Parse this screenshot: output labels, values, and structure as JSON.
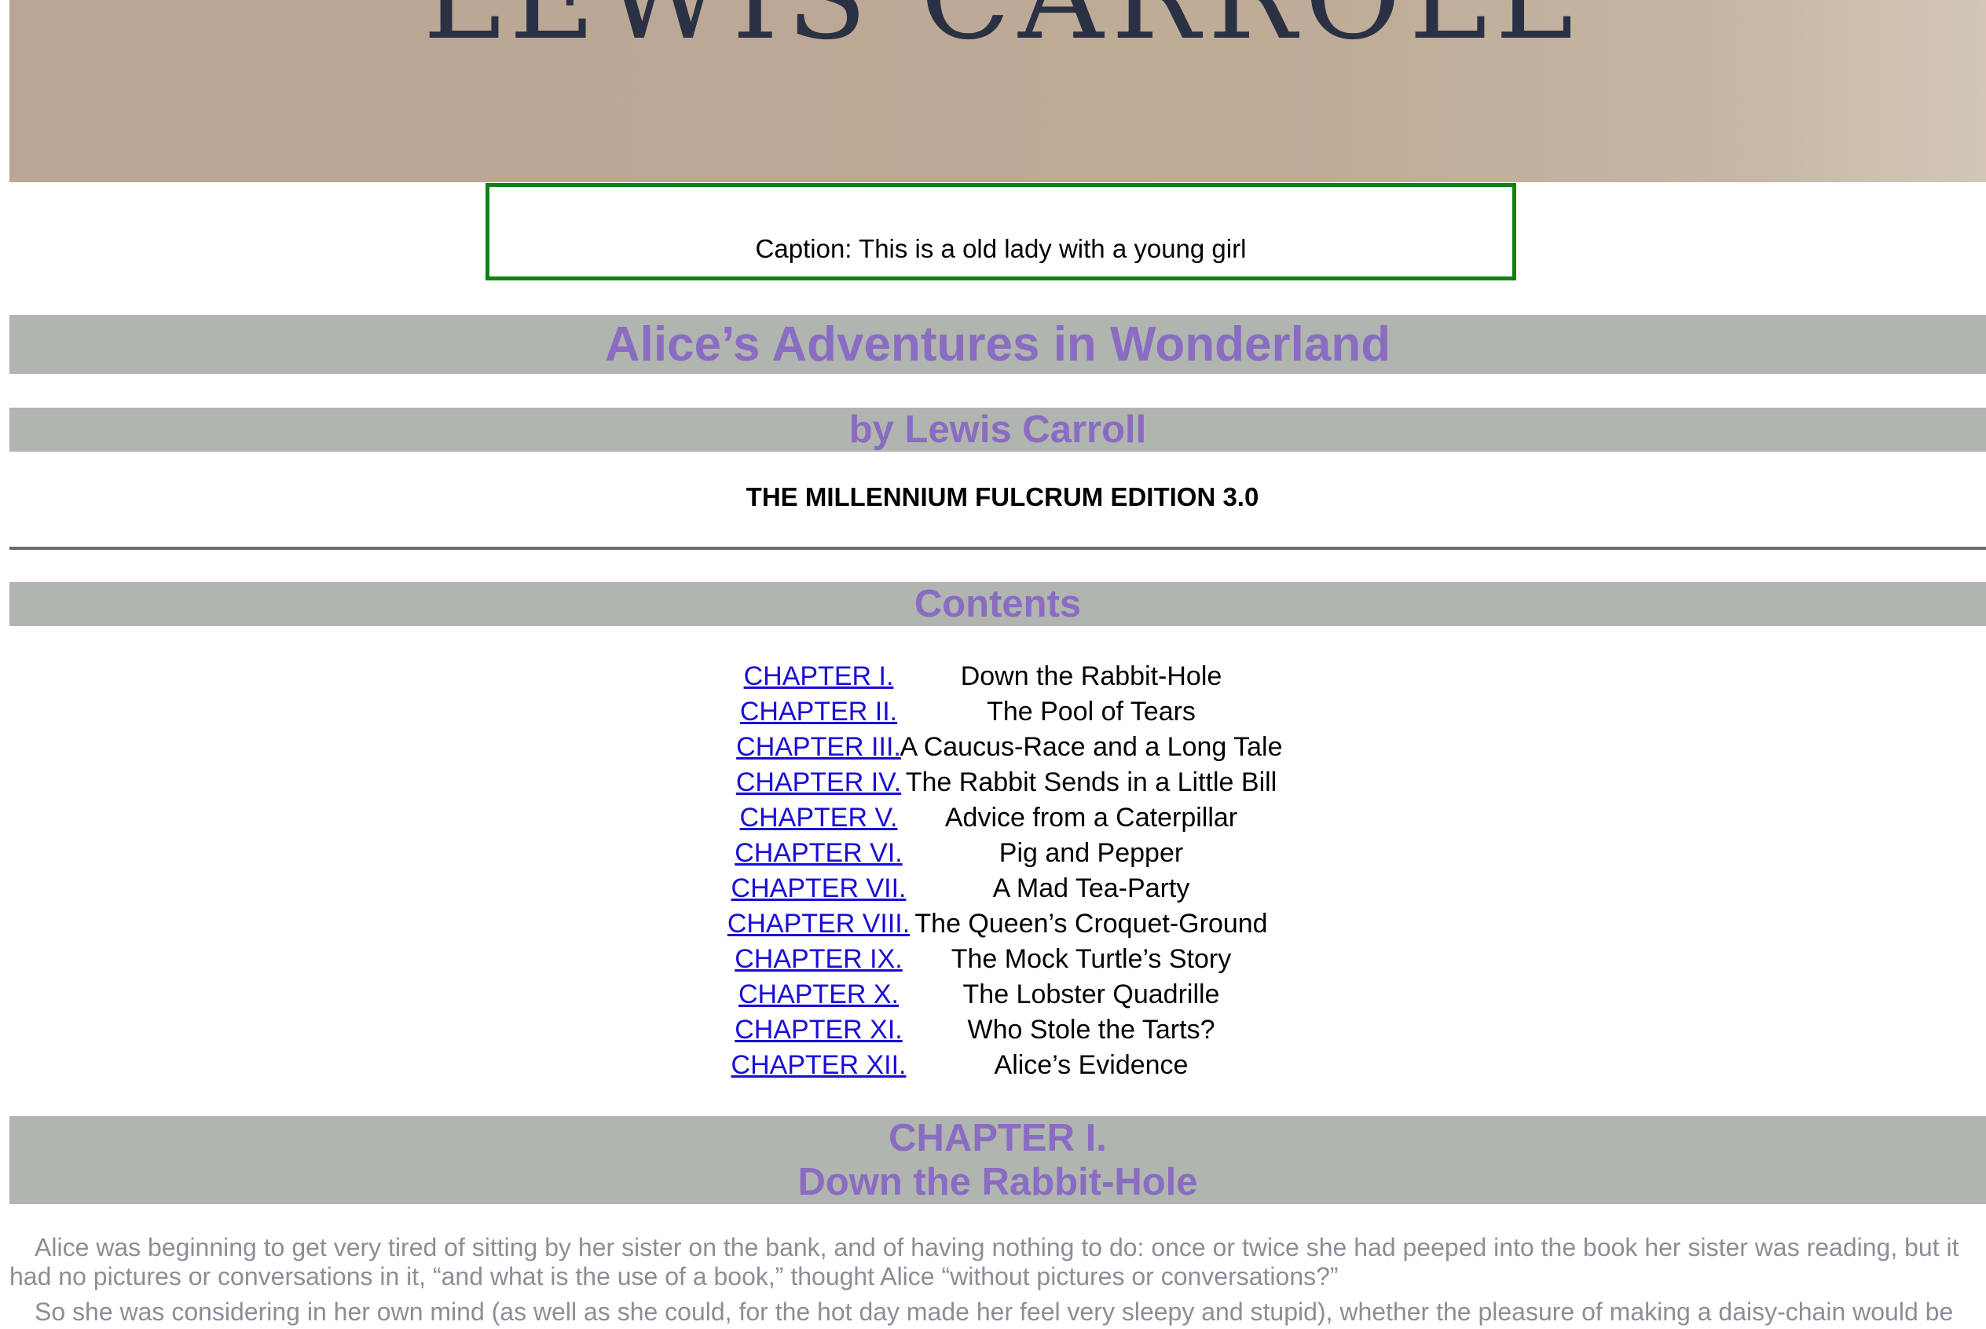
{
  "cover": {
    "text": "LEWIS CARROLL"
  },
  "caption": {
    "text": "Caption: This is a old lady with a young girl",
    "border_color": "#128112"
  },
  "book": {
    "title": "Alice’s Adventures in Wonderland",
    "author": "by Lewis Carroll",
    "edition": "THE MILLENNIUM FULCRUM EDITION 3.0"
  },
  "colors": {
    "heading_text": "#8a6cc2",
    "heading_band": "#b0b5b0",
    "link": "#1a0dd6",
    "body_text": "#8a8f97"
  },
  "contents": {
    "heading": "Contents",
    "items": [
      {
        "chapter": "CHAPTER I.",
        "title": "Down the Rabbit-Hole"
      },
      {
        "chapter": "CHAPTER II.",
        "title": "The Pool of Tears"
      },
      {
        "chapter": "CHAPTER III.",
        "title": "A Caucus-Race and a Long Tale"
      },
      {
        "chapter": "CHAPTER IV.",
        "title": "The Rabbit Sends in a Little Bill"
      },
      {
        "chapter": "CHAPTER V.",
        "title": "Advice from a Caterpillar"
      },
      {
        "chapter": "CHAPTER VI.",
        "title": "Pig and Pepper"
      },
      {
        "chapter": "CHAPTER VII.",
        "title": "A Mad Tea-Party"
      },
      {
        "chapter": "CHAPTER VIII.",
        "title": "The Queen’s Croquet-Ground"
      },
      {
        "chapter": "CHAPTER IX.",
        "title": "The Mock Turtle’s Story"
      },
      {
        "chapter": "CHAPTER X.",
        "title": "The Lobster Quadrille"
      },
      {
        "chapter": "CHAPTER XI.",
        "title": "Who Stole the Tarts?"
      },
      {
        "chapter": "CHAPTER XII.",
        "title": "Alice’s Evidence"
      }
    ]
  },
  "chapter1": {
    "number": "CHAPTER I.",
    "title": "Down the Rabbit-Hole",
    "paragraphs": [
      "Alice was beginning to get very tired of sitting by her sister on the bank, and of having nothing to do: once or twice she had peeped into the book her sister was reading, but it had no pictures or conversations in it, “and what is the use of a book,” thought Alice “without pictures or conversations?”",
      "So she was considering in her own mind (as well as she could, for the hot day made her feel very sleepy and stupid), whether the pleasure of making a daisy-chain would be"
    ]
  }
}
